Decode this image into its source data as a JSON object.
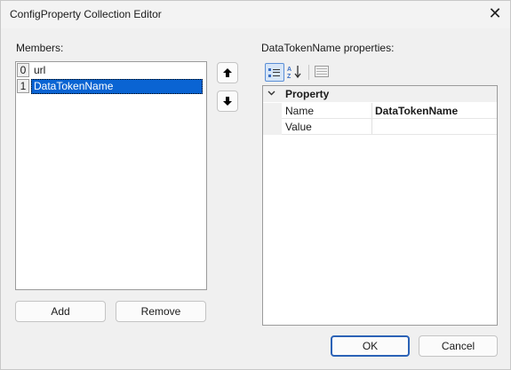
{
  "window": {
    "title": "ConfigProperty Collection Editor",
    "close_glyph": "✕"
  },
  "members": {
    "label": "Members:",
    "items": [
      {
        "index": "0",
        "name": "url"
      },
      {
        "index": "1",
        "name": "DataTokenName",
        "selected": true
      }
    ],
    "move_up_glyph": "🡅",
    "move_down_glyph": "🡇",
    "add_label": "Add",
    "remove_label": "Remove"
  },
  "properties": {
    "label": "DataTokenName properties:",
    "toolbar": {
      "categorized_icon": "categorized-icon",
      "alphabetical_icon": "alphabetical-icon",
      "pages_icon": "property-pages-icon"
    },
    "category": "Property",
    "rows": [
      {
        "name": "Name",
        "value": "DataTokenName"
      },
      {
        "name": "Value",
        "value": ""
      }
    ]
  },
  "footer": {
    "ok_label": "OK",
    "cancel_label": "Cancel"
  },
  "colors": {
    "selection": "#0a64d3",
    "primary_border": "#2b62b6"
  }
}
